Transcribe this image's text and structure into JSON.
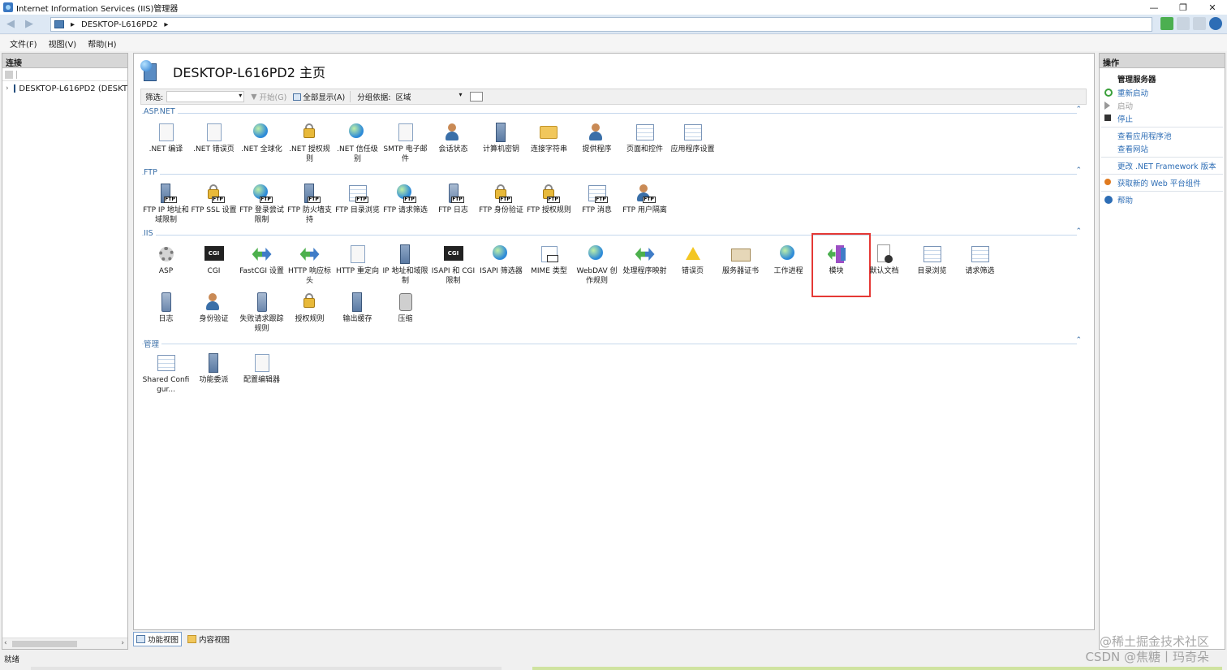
{
  "window": {
    "title": "Internet Information Services (IIS)管理器",
    "controls": [
      "—",
      "❐",
      "✕"
    ]
  },
  "address": {
    "server": "DESKTOP-L616PD2"
  },
  "menu": [
    "文件(F)",
    "视图(V)",
    "帮助(H)"
  ],
  "connections": {
    "header": "连接",
    "node": "DESKTOP-L616PD2 (DESKT"
  },
  "center": {
    "title": "DESKTOP-L616PD2 主页",
    "filter": {
      "label": "筛选:",
      "start": "开始(G)",
      "show_all": "全部显示(A)",
      "group_by": "分组依据:",
      "group_value": "区域"
    },
    "groups": [
      {
        "name": "ASP.NET",
        "items": [
          ".NET 编译",
          ".NET 错误页",
          ".NET 全球化",
          ".NET 授权规则",
          ".NET 信任级别",
          "SMTP 电子邮件",
          "会话状态",
          "计算机密钥",
          "连接字符串",
          "提供程序",
          "页面和控件",
          "应用程序设置"
        ]
      },
      {
        "name": "FTP",
        "items": [
          "FTP IP 地址和域限制",
          "FTP SSL 设置",
          "FTP 登录尝试限制",
          "FTP 防火墙支持",
          "FTP 目录浏览",
          "FTP 请求筛选",
          "FTP 日志",
          "FTP 身份验证",
          "FTP 授权规则",
          "FTP 消息",
          "FTP 用户隔离"
        ]
      },
      {
        "name": "IIS",
        "items": [
          "ASP",
          "CGI",
          "FastCGI 设置",
          "HTTP 响应标头",
          "HTTP 重定向",
          "IP 地址和域限制",
          "ISAPI 和 CGI 限制",
          "ISAPI 筛选器",
          "MIME 类型",
          "WebDAV 创作规则",
          "处理程序映射",
          "错误页",
          "服务器证书",
          "工作进程",
          "模块",
          "默认文档",
          "目录浏览",
          "请求筛选",
          "日志",
          "身份验证",
          "失败请求跟踪规则",
          "授权规则",
          "输出缓存",
          "压缩"
        ]
      },
      {
        "name": "管理",
        "items": [
          "Shared Configur...",
          "功能委派",
          "配置编辑器"
        ]
      }
    ]
  },
  "bottom_tabs": [
    "功能视图",
    "内容视图"
  ],
  "actions": {
    "header": "操作",
    "section": "管理服务器",
    "restart": "重新启动",
    "start": "启动",
    "stop": "停止",
    "view_pools": "查看应用程序池",
    "view_sites": "查看网站",
    "change_net": "更改 .NET Framework 版本",
    "get_components": "获取新的 Web 平台组件",
    "help": "帮助"
  },
  "status": {
    "text": "就绪"
  },
  "watermark": {
    "line1": "@稀土掘金技术社区",
    "line2": "CSDN @焦糖丨玛奇朵"
  },
  "colors": {
    "link": "#2d6db5",
    "group_header": "#3b6fa7",
    "highlight_box": "#e53935"
  }
}
